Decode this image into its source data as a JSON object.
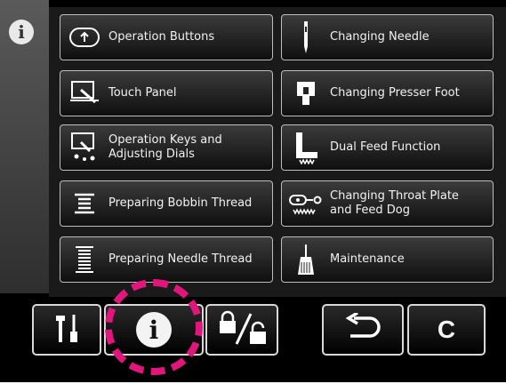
{
  "menu": {
    "left": [
      {
        "label": "Operation Buttons",
        "icon": "operation-buttons-icon"
      },
      {
        "label": "Touch Panel",
        "icon": "touch-panel-icon"
      },
      {
        "label": "Operation Keys and\nAdjusting Dials",
        "icon": "operation-keys-icon"
      },
      {
        "label": "Preparing Bobbin Thread",
        "icon": "bobbin-thread-icon"
      },
      {
        "label": "Preparing Needle Thread",
        "icon": "needle-thread-icon"
      }
    ],
    "right": [
      {
        "label": "Changing Needle",
        "icon": "needle-icon"
      },
      {
        "label": "Changing Presser Foot",
        "icon": "presser-foot-icon"
      },
      {
        "label": "Dual Feed Function",
        "icon": "dual-feed-icon"
      },
      {
        "label": "Changing Throat Plate\nand Feed Dog",
        "icon": "throat-plate-icon"
      },
      {
        "label": "Maintenance",
        "icon": "maintenance-icon"
      }
    ]
  },
  "info_symbol": "i",
  "clear_label": "C",
  "colors": {
    "highlight": "#e0167c",
    "background": "#000000",
    "button_border": "#bdbdbd"
  }
}
